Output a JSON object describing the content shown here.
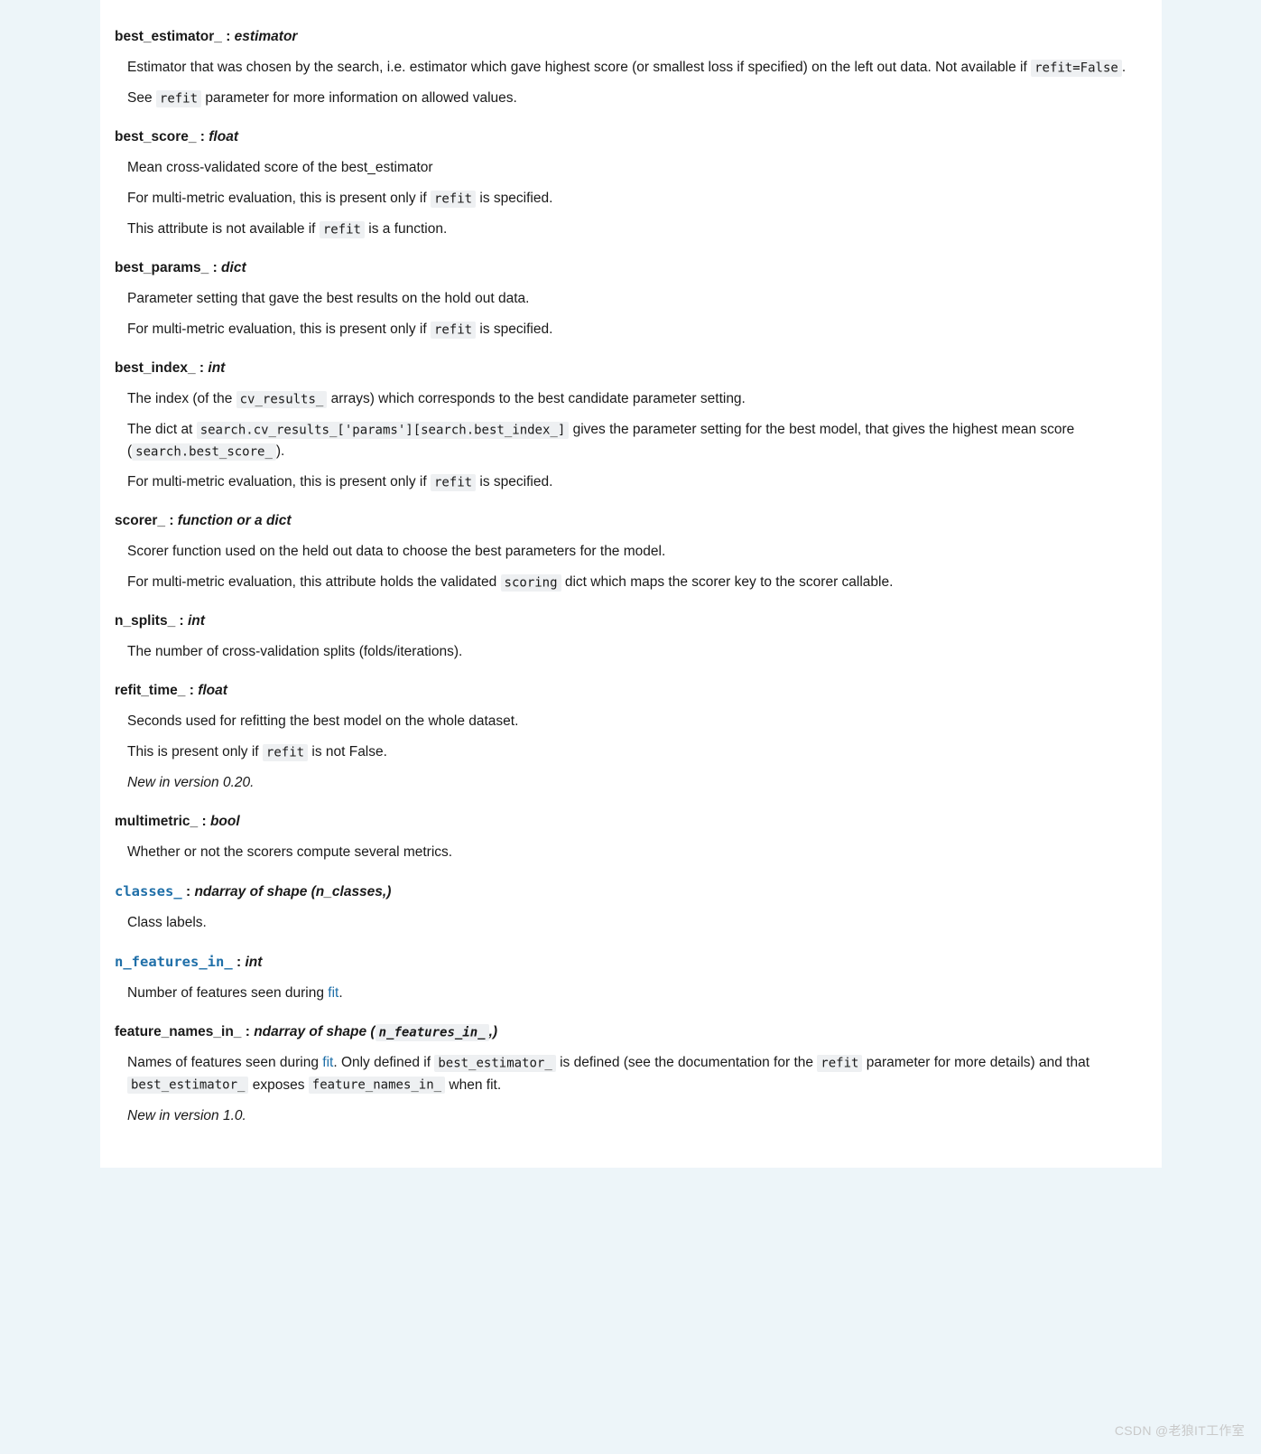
{
  "watermark": "CSDN @老狼IT工作室",
  "attrs": [
    {
      "name": "best_estimator_",
      "type": "estimator",
      "p1a": "Estimator that was chosen by the search, i.e. estimator which gave highest score (or smallest loss if specified) on the left out data. Not available if ",
      "p1code": "refit=False",
      "p1b": ".",
      "p2a": "See ",
      "p2code": "refit",
      "p2b": " parameter for more information on allowed values."
    },
    {
      "name": "best_score_",
      "type": "float",
      "p1": "Mean cross-validated score of the best_estimator",
      "p2a": "For multi-metric evaluation, this is present only if ",
      "p2code": "refit",
      "p2b": " is specified.",
      "p3a": "This attribute is not available if ",
      "p3code": "refit",
      "p3b": " is a function."
    },
    {
      "name": "best_params_",
      "type": "dict",
      "p1": "Parameter setting that gave the best results on the hold out data.",
      "p2a": "For multi-metric evaluation, this is present only if ",
      "p2code": "refit",
      "p2b": " is specified."
    },
    {
      "name": "best_index_",
      "type": "int",
      "p1a": "The index (of the ",
      "p1code": "cv_results_",
      "p1b": " arrays) which corresponds to the best candidate parameter setting.",
      "p2a": "The dict at ",
      "p2code1": "search.cv_results_['params'][search.best_index_]",
      "p2b": " gives the parameter setting for the best model, that gives the highest mean score (",
      "p2code2": "search.best_score_",
      "p2c": ").",
      "p3a": "For multi-metric evaluation, this is present only if ",
      "p3code": "refit",
      "p3b": " is specified."
    },
    {
      "name": "scorer_",
      "type": "function or a dict",
      "p1": "Scorer function used on the held out data to choose the best parameters for the model.",
      "p2a": "For multi-metric evaluation, this attribute holds the validated ",
      "p2code": "scoring",
      "p2b": " dict which maps the scorer key to the scorer callable."
    },
    {
      "name": "n_splits_",
      "type": "int",
      "p1": "The number of cross-validation splits (folds/iterations)."
    },
    {
      "name": "refit_time_",
      "type": "float",
      "p1": "Seconds used for refitting the best model on the whole dataset.",
      "p2a": "This is present only if ",
      "p2code": "refit",
      "p2b": " is not False.",
      "vn": "New in version 0.20."
    },
    {
      "name": "multimetric_",
      "type": "bool",
      "p1": "Whether or not the scorers compute several metrics."
    },
    {
      "namecode": "classes_",
      "type": "ndarray of shape (n_classes,)",
      "p1": "Class labels."
    },
    {
      "namecode": "n_features_in_",
      "type": "int",
      "p1a": "Number of features seen during ",
      "p1link": "fit",
      "p1b": "."
    },
    {
      "name": "feature_names_in_",
      "type_prefix": "ndarray of shape (",
      "type_code": "n_features_in_",
      "type_suffix": ",)",
      "p1a": "Names of features seen during ",
      "p1link": "fit",
      "p1b": ". Only defined if ",
      "p1code1": "best_estimator_",
      "p1c": " is defined (see the documentation for the ",
      "p1code2": "refit",
      "p1d": " parameter for more details) and that ",
      "p1code3": "best_estimator_",
      "p1e": " exposes ",
      "p1code4": "feature_names_in_",
      "p1f": " when fit.",
      "vn": "New in version 1.0."
    }
  ]
}
